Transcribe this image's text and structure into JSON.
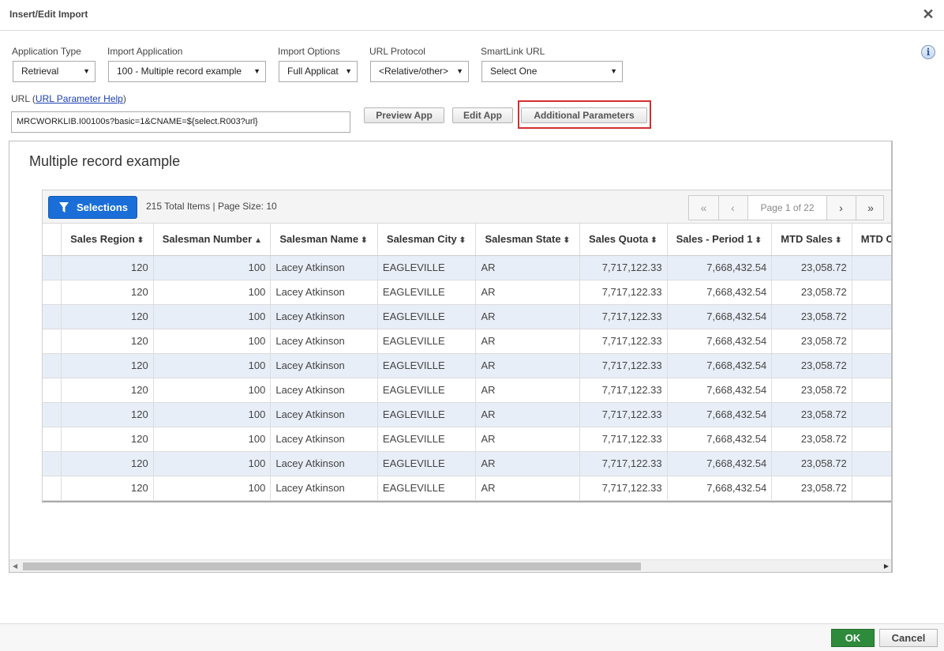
{
  "dialog": {
    "title": "Insert/Edit Import"
  },
  "fields": {
    "application_type": {
      "label": "Application Type",
      "value": "Retrieval"
    },
    "import_application": {
      "label": "Import Application",
      "value": "100 - Multiple record example"
    },
    "import_options": {
      "label": "Import Options",
      "value": "Full Applicat"
    },
    "url_protocol": {
      "label": "URL Protocol",
      "value": "<Relative/other>"
    },
    "smartlink_url": {
      "label": "SmartLink URL",
      "value": "Select One"
    }
  },
  "url": {
    "label": "URL",
    "help_link": "URL Parameter Help",
    "value": "MRCWORKLIB.I00100s?basic=1&CNAME=${select.R003?url}"
  },
  "buttons": {
    "preview": "Preview App",
    "edit": "Edit App",
    "additional": "Additional Parameters",
    "ok": "OK",
    "cancel": "Cancel"
  },
  "preview": {
    "app_title": "Multiple record example",
    "selections_label": "Selections",
    "total_items": "215 Total Items | Page Size: 10",
    "page_info": "Page 1 of 22"
  },
  "grid": {
    "columns": [
      {
        "label": "",
        "sort": ""
      },
      {
        "label": "Sales Region",
        "sort": "both"
      },
      {
        "label": "Salesman Number",
        "sort": "asc"
      },
      {
        "label": "Salesman Name",
        "sort": "both"
      },
      {
        "label": "Salesman City",
        "sort": "both"
      },
      {
        "label": "Salesman State",
        "sort": "both"
      },
      {
        "label": "Sales Quota",
        "sort": "both"
      },
      {
        "label": "Sales - Period 1",
        "sort": "both"
      },
      {
        "label": "MTD Sales",
        "sort": "both"
      },
      {
        "label": "MTD C",
        "sort": ""
      }
    ],
    "rows": [
      [
        "",
        "120",
        "100",
        "Lacey Atkinson",
        "EAGLEVILLE",
        "AR",
        "7,717,122.33",
        "7,668,432.54",
        "23,058.72",
        ""
      ],
      [
        "",
        "120",
        "100",
        "Lacey Atkinson",
        "EAGLEVILLE",
        "AR",
        "7,717,122.33",
        "7,668,432.54",
        "23,058.72",
        ""
      ],
      [
        "",
        "120",
        "100",
        "Lacey Atkinson",
        "EAGLEVILLE",
        "AR",
        "7,717,122.33",
        "7,668,432.54",
        "23,058.72",
        ""
      ],
      [
        "",
        "120",
        "100",
        "Lacey Atkinson",
        "EAGLEVILLE",
        "AR",
        "7,717,122.33",
        "7,668,432.54",
        "23,058.72",
        ""
      ],
      [
        "",
        "120",
        "100",
        "Lacey Atkinson",
        "EAGLEVILLE",
        "AR",
        "7,717,122.33",
        "7,668,432.54",
        "23,058.72",
        ""
      ],
      [
        "",
        "120",
        "100",
        "Lacey Atkinson",
        "EAGLEVILLE",
        "AR",
        "7,717,122.33",
        "7,668,432.54",
        "23,058.72",
        ""
      ],
      [
        "",
        "120",
        "100",
        "Lacey Atkinson",
        "EAGLEVILLE",
        "AR",
        "7,717,122.33",
        "7,668,432.54",
        "23,058.72",
        ""
      ],
      [
        "",
        "120",
        "100",
        "Lacey Atkinson",
        "EAGLEVILLE",
        "AR",
        "7,717,122.33",
        "7,668,432.54",
        "23,058.72",
        ""
      ],
      [
        "",
        "120",
        "100",
        "Lacey Atkinson",
        "EAGLEVILLE",
        "AR",
        "7,717,122.33",
        "7,668,432.54",
        "23,058.72",
        ""
      ],
      [
        "",
        "120",
        "100",
        "Lacey Atkinson",
        "EAGLEVILLE",
        "AR",
        "7,717,122.33",
        "7,668,432.54",
        "23,058.72",
        ""
      ]
    ]
  },
  "colors": {
    "selections_button": "#1a6ed8",
    "ok_button": "#2e8b3c",
    "highlight": "#d32f2f",
    "row_alt": "#e8eef7"
  },
  "icons": {
    "close": "close-icon",
    "info": "info-icon",
    "filter": "funnel-icon",
    "sort": "sort-icon"
  }
}
